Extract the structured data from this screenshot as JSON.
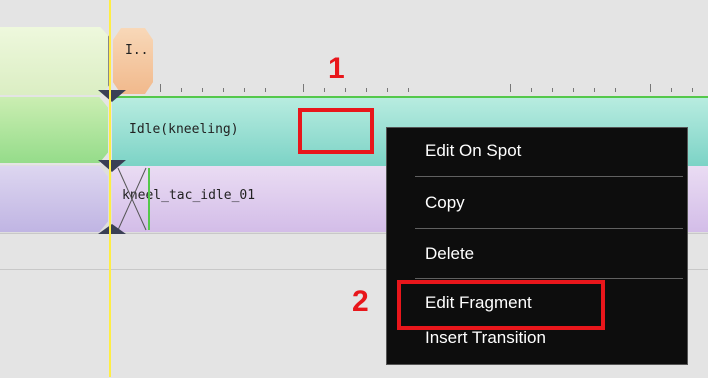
{
  "timeline": {
    "top_clip_label": "I..",
    "mid_clip_label": "Idle(kneeling)",
    "bottom_clip_label": "kneel_tac_idle_01"
  },
  "context_menu": {
    "items": [
      {
        "label": "Edit On Spot"
      },
      {
        "label": "Copy"
      },
      {
        "label": "Delete"
      },
      {
        "label": "Edit Fragment"
      },
      {
        "label": "Insert Transition"
      }
    ]
  },
  "annotations": {
    "step1": "1",
    "step2": "2"
  },
  "colors": {
    "annotation_red": "#e8161b",
    "menu_bg": "#0d0d0d",
    "playhead": "#ffee44"
  }
}
